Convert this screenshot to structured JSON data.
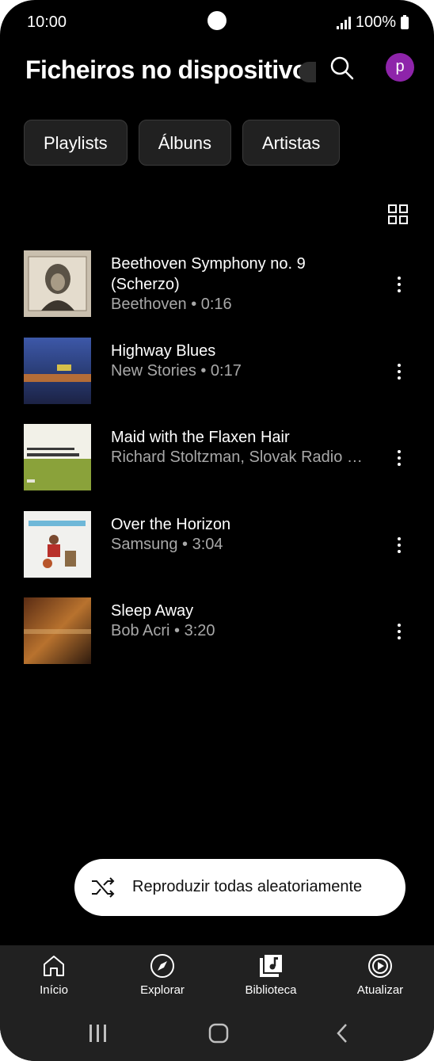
{
  "status_bar": {
    "time": "10:00",
    "battery": "100%"
  },
  "header": {
    "title": "Ficheiros no dispositivo",
    "avatar_letter": "p"
  },
  "chips": [
    "Playlists",
    "Álbuns",
    "Artistas"
  ],
  "tracks": [
    {
      "title": "Beethoven Symphony no. 9 (Scherzo)",
      "subtitle": "Beethoven • 0:16"
    },
    {
      "title": "Highway Blues",
      "subtitle": "New Stories • 0:17"
    },
    {
      "title": "Maid with the Flaxen Hair",
      "subtitle": "Richard Stoltzman, Slovak Radio …"
    },
    {
      "title": "Over the Horizon",
      "subtitle": "Samsung • 3:04"
    },
    {
      "title": "Sleep Away",
      "subtitle": "Bob Acri • 3:20"
    }
  ],
  "shuffle_label": "Reproduzir todas aleatoriamente",
  "bottom_nav": [
    "Início",
    "Explorar",
    "Biblioteca",
    "Atualizar"
  ],
  "icons": {
    "search": "search-icon",
    "grid": "grid-view-icon",
    "more": "more-vert-icon",
    "shuffle": "shuffle-icon",
    "home": "home-icon",
    "explore": "compass-icon",
    "library": "library-music-icon",
    "upgrade": "play-circle-icon"
  },
  "colors": {
    "background": "#000000",
    "avatar": "#8e24aa",
    "chip": "#212121",
    "nav": "#212121"
  }
}
